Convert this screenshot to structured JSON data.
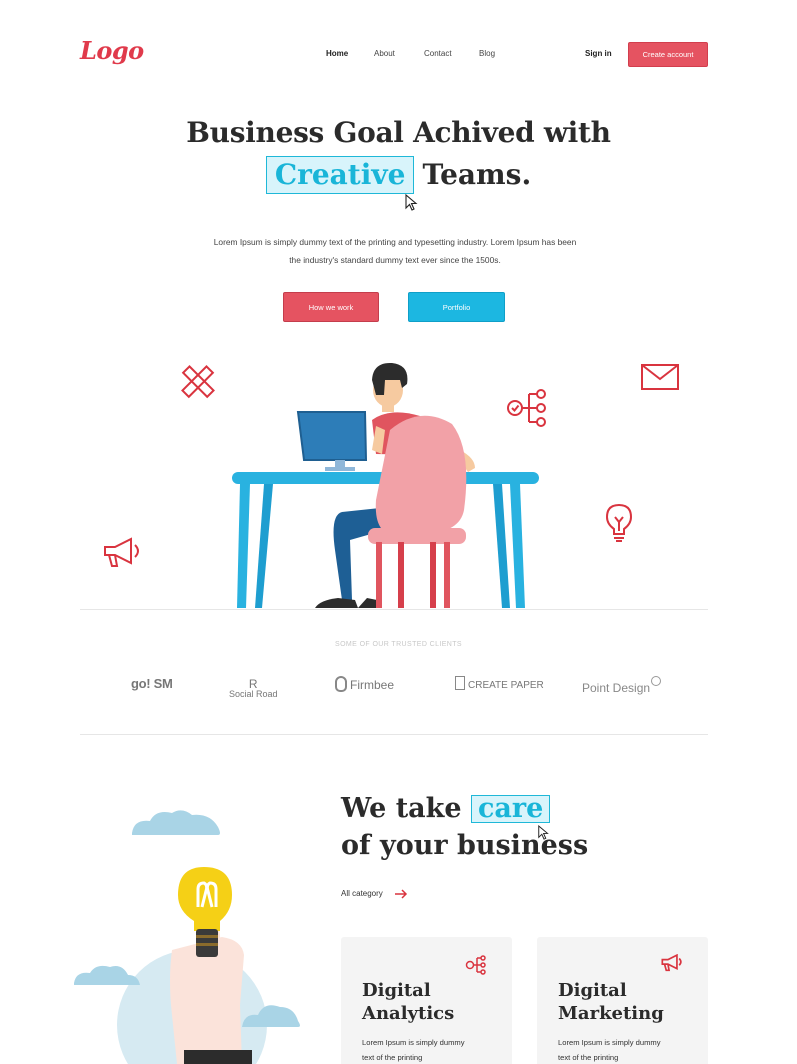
{
  "header": {
    "logo": "Logo",
    "nav": [
      "Home",
      "About",
      "Contact",
      "Blog"
    ],
    "signin": "Sign in",
    "create_account": "Create account"
  },
  "hero": {
    "title_line1": "Business Goal Achived with",
    "title_highlight": "Creative",
    "title_line2_rest": "Teams.",
    "description_line1": "Lorem Ipsum is simply dummy text of the printing and typesetting industry. Lorem Ipsum has been",
    "description_line2": "the industry's standard dummy text ever since the 1500s.",
    "btn_primary": "How we work",
    "btn_secondary": "Portfolio"
  },
  "clients": {
    "title": "SOME OF OUR TRUSTED CLIENTS",
    "logos": [
      "go! SM",
      "Social Road",
      "Firmbee",
      "CREATE PAPER",
      "Point Design"
    ]
  },
  "care": {
    "line1_prefix": "We take",
    "highlight": "care",
    "line2": "of your business",
    "all_category": "All category"
  },
  "cards": [
    {
      "title_l1": "Digital",
      "title_l2": "Analytics",
      "text_l1": "Lorem Ipsum is simply dummy",
      "text_l2": "text of the printing",
      "icon": "network-icon"
    },
    {
      "title_l1": "Digital",
      "title_l2": "Marketing",
      "text_l1": "Lorem Ipsum is simply dummy",
      "text_l2": "text of the printing",
      "icon": "megaphone-icon"
    }
  ],
  "colors": {
    "accent_red": "#e55361",
    "accent_blue": "#1cb7e1",
    "highlight_bg": "#d8f4fb"
  }
}
